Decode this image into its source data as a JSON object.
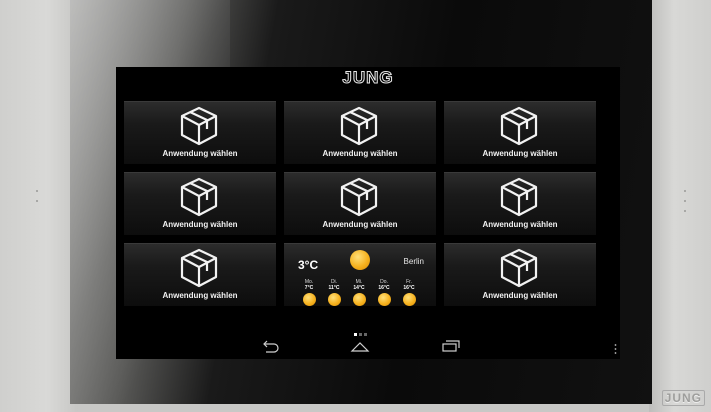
{
  "brand": {
    "name": "JUNG"
  },
  "tiles": [
    {
      "label": "Anwendung wählen"
    },
    {
      "label": "Anwendung wählen"
    },
    {
      "label": "Anwendung wählen"
    },
    {
      "label": "Anwendung wählen"
    },
    {
      "label": "Anwendung wählen"
    },
    {
      "label": "Anwendung wählen"
    },
    {
      "label": "Anwendung wählen"
    },
    {
      "label": "Anwendung wählen"
    }
  ],
  "weather": {
    "temperature": "3°C",
    "city": "Berlin",
    "icon": "sun-icon",
    "forecast": [
      {
        "day": "Mo.",
        "temp": "7°C",
        "icon": "sun-icon"
      },
      {
        "day": "Di.",
        "temp": "11°C",
        "icon": "sun-icon"
      },
      {
        "day": "Mi.",
        "temp": "14°C",
        "icon": "sun-icon"
      },
      {
        "day": "Do.",
        "temp": "16°C",
        "icon": "sun-icon"
      },
      {
        "day": "Fr.",
        "temp": "16°C",
        "icon": "sun-icon"
      }
    ]
  },
  "pager": {
    "pages": 3,
    "active": 1
  },
  "navbar": {
    "buttons": [
      "back-icon",
      "home-icon",
      "recents-icon"
    ],
    "overflow": "more-vert-icon"
  },
  "colors": {
    "screen": "#000000",
    "tile_text": "#f2f2f2",
    "sun": "#f6b21f",
    "frame": "#d6d6d4"
  }
}
